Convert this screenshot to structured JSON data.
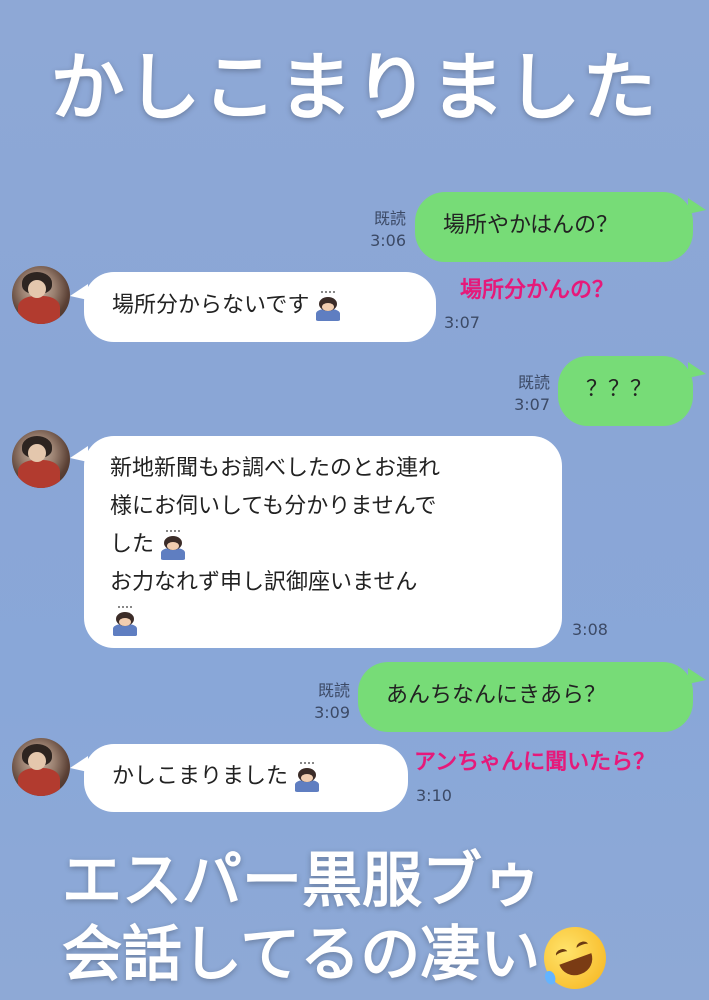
{
  "title": "かしこまりました",
  "messages": {
    "m1": {
      "text": "場所やかはんの？",
      "read": "既読",
      "time": "3:06"
    },
    "m2": {
      "text": "場所分からないです",
      "time": "3:07"
    },
    "m3": {
      "text": "？？？",
      "read": "既読",
      "time": "3:07"
    },
    "m4": {
      "line1": "新地新聞もお調べしたのとお連れ",
      "line2": "様にお伺いしても分かりませんで",
      "line3": "した",
      "line4": "お力なれず申し訳御座いません",
      "time": "3:08"
    },
    "m5": {
      "text": "あんちなんにきあら？",
      "read": "既読",
      "time": "3:09"
    },
    "m6": {
      "text": "かしこまりました",
      "time": "3:10"
    }
  },
  "annotations": {
    "a1": "場所分かんの？",
    "a2": "アンちゃんに聞いたら？"
  },
  "caption": {
    "line1": "エスパー黒服ブゥ",
    "line2": "会話してるの凄い"
  },
  "icons": [
    "bowing-person-icon",
    "rolling-laughing-icon",
    "avatar"
  ]
}
